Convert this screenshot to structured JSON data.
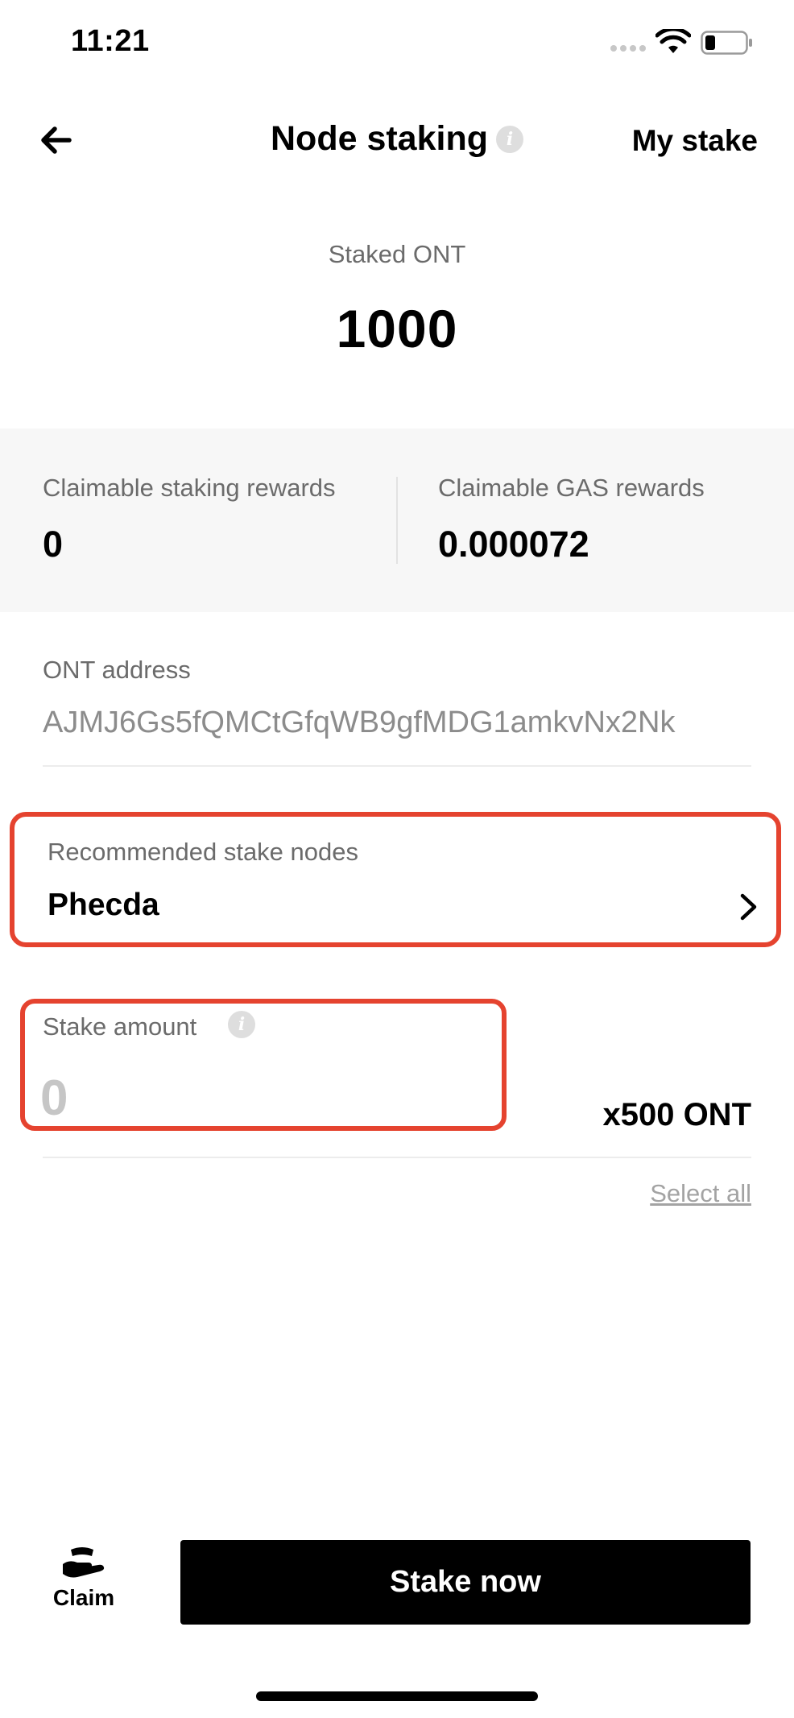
{
  "status_bar": {
    "time": "11:21"
  },
  "nav": {
    "title": "Node staking",
    "my_stake_label": "My stake"
  },
  "staked": {
    "label": "Staked ONT",
    "value": "1000"
  },
  "rewards": {
    "staking_label": "Claimable staking rewards",
    "staking_value": "0",
    "gas_label": "Claimable GAS rewards",
    "gas_value": "0.000072"
  },
  "address": {
    "label": "ONT address",
    "value": "AJMJ6Gs5fQMCtGfqWB9gfMDG1amkvNx2Nk"
  },
  "node": {
    "label": "Recommended stake nodes",
    "name": "Phecda"
  },
  "amount": {
    "label": "Stake amount",
    "placeholder": "0",
    "unit": "x500 ONT",
    "select_all": "Select all"
  },
  "bottom": {
    "claim_label": "Claim",
    "stake_now_label": "Stake now"
  },
  "colors": {
    "highlight": "#e5432f",
    "primary_button": "#000000",
    "panel_bg": "#f7f7f7"
  }
}
